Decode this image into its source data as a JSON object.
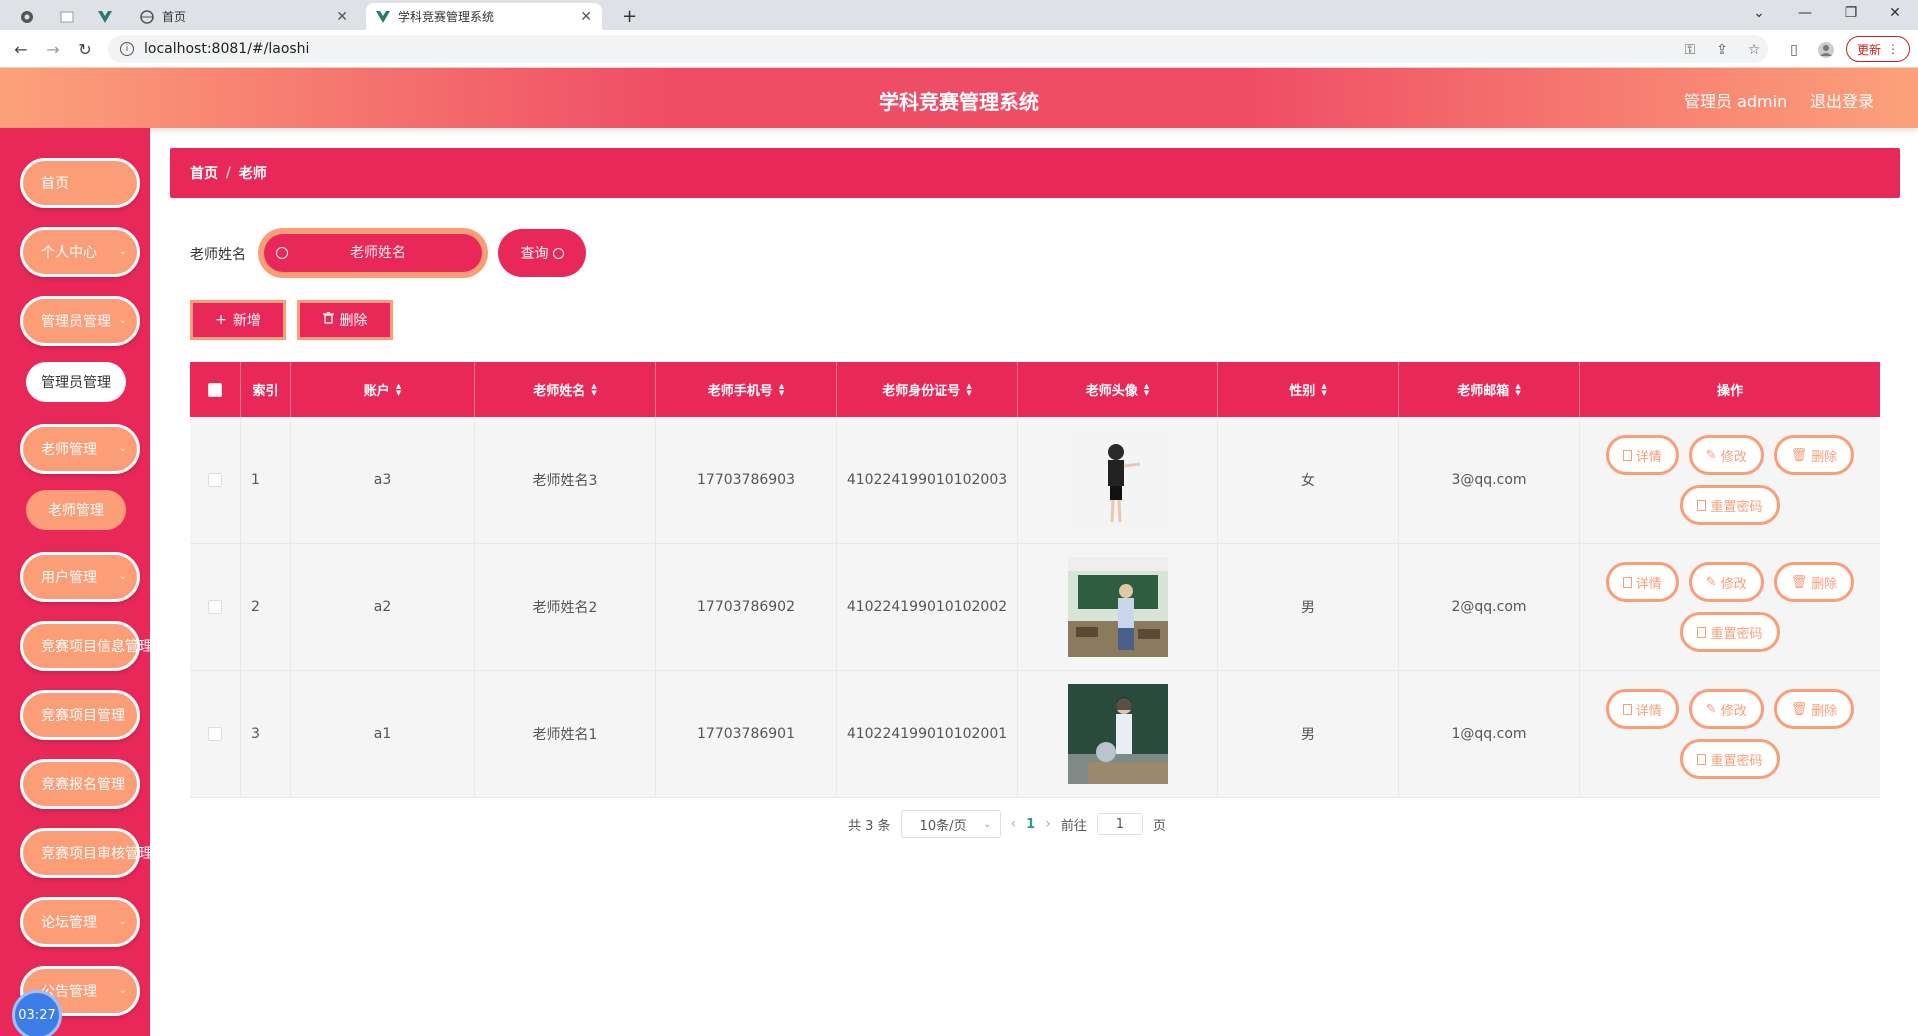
{
  "browser": {
    "tabs": [
      {
        "title": "首页"
      },
      {
        "title": "学科竞赛管理系统"
      }
    ],
    "url": "localhost:8081/#/laoshi",
    "update_label": "更新"
  },
  "header": {
    "title": "学科竞赛管理系统",
    "user": "管理员 admin",
    "logout": "退出登录"
  },
  "sidebar": {
    "items": [
      {
        "label": "首页"
      },
      {
        "label": "个人中心"
      },
      {
        "label": "管理员管理"
      },
      {
        "label": "管理员管理"
      },
      {
        "label": "老师管理"
      },
      {
        "label": "老师管理"
      },
      {
        "label": "用户管理"
      },
      {
        "label": "竞赛项目信息管理"
      },
      {
        "label": "竞赛项目管理"
      },
      {
        "label": "竞赛报名管理"
      },
      {
        "label": "竞赛项目审核管理"
      },
      {
        "label": "论坛管理"
      },
      {
        "label": "公告管理"
      }
    ],
    "clock": "03:27"
  },
  "breadcrumb": {
    "home": "首页",
    "sep": "/",
    "current": "老师"
  },
  "search": {
    "label": "老师姓名",
    "placeholder": "老师姓名",
    "query_label": "查询"
  },
  "actions": {
    "add_label": "新增",
    "delete_label": "删除"
  },
  "table": {
    "headers": {
      "index": "索引",
      "account": "账户",
      "name": "老师姓名",
      "phone": "老师手机号",
      "id_card": "老师身份证号",
      "avatar": "老师头像",
      "gender": "性别",
      "email": "老师邮箱",
      "ops": "操作"
    },
    "rows": [
      {
        "index": "1",
        "account": "a3",
        "name": "老师姓名3",
        "phone": "17703786903",
        "id_card": "410224199010102003",
        "gender": "女",
        "email": "3@qq.com"
      },
      {
        "index": "2",
        "account": "a2",
        "name": "老师姓名2",
        "phone": "17703786902",
        "id_card": "410224199010102002",
        "gender": "男",
        "email": "2@qq.com"
      },
      {
        "index": "3",
        "account": "a1",
        "name": "老师姓名1",
        "phone": "17703786901",
        "id_card": "410224199010102001",
        "gender": "男",
        "email": "1@qq.com"
      }
    ],
    "op_labels": {
      "detail": "详情",
      "edit": "修改",
      "delete": "删除",
      "reset": "重置密码"
    }
  },
  "pagination": {
    "total": "共 3 条",
    "page_size": "10条/页",
    "current": "1",
    "goto_prefix": "前往",
    "goto_value": "1",
    "goto_suffix": "页"
  },
  "colors": {
    "primary": "#e9285a",
    "secondary": "#fb9d76"
  }
}
